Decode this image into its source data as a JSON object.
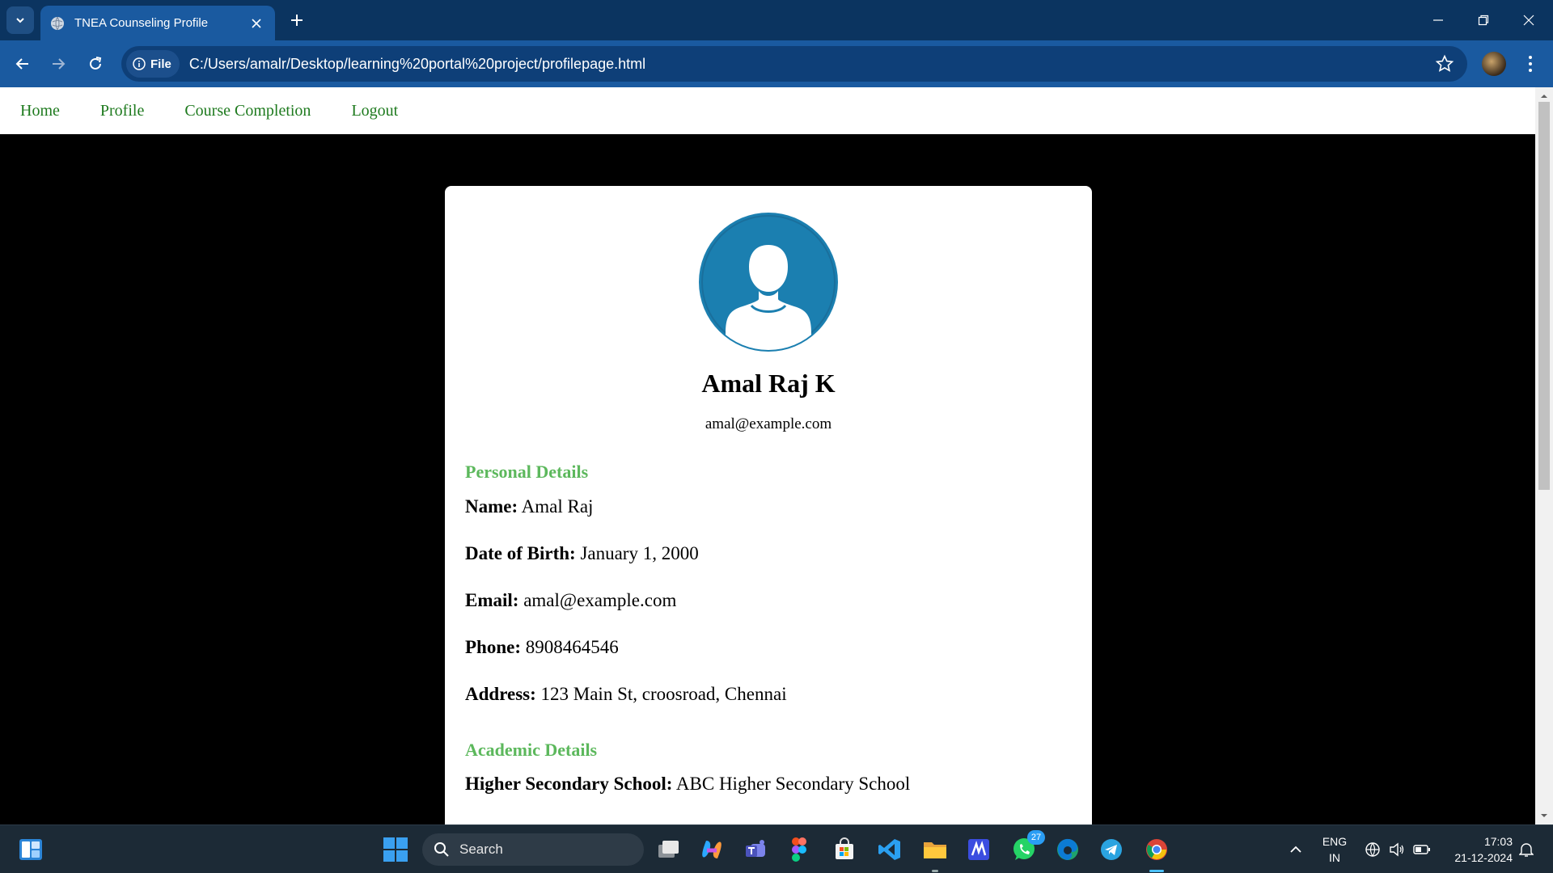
{
  "browser": {
    "tab_title": "TNEA Counseling Profile",
    "omnibox_chip": "File",
    "url": "C:/Users/amalr/Desktop/learning%20portal%20project/profilepage.html"
  },
  "site_nav": {
    "items": [
      "Home",
      "Profile",
      "Course Completion",
      "Logout"
    ]
  },
  "profile": {
    "name": "Amal Raj K",
    "email": "amal@example.com",
    "personal_title": "Personal Details",
    "personal": [
      {
        "label": "Name:",
        "value": "Amal Raj"
      },
      {
        "label": "Date of Birth:",
        "value": "January 1, 2000"
      },
      {
        "label": "Email:",
        "value": "amal@example.com"
      },
      {
        "label": "Phone:",
        "value": "8908464546"
      },
      {
        "label": "Address:",
        "value": "123 Main St, croosroad, Chennai"
      }
    ],
    "academic_title": "Academic Details",
    "academic": [
      {
        "label": "Higher Secondary School:",
        "value": "ABC Higher Secondary School"
      }
    ]
  },
  "taskbar": {
    "search_placeholder": "Search",
    "whatsapp_badge": "27",
    "lang_line1": "ENG",
    "lang_line2": "IN",
    "time": "17:03",
    "date": "21-12-2024"
  },
  "colors": {
    "nav_link": "#1e7a1e",
    "section_heading": "#5cb85c",
    "avatar_circle": "#1b7fb0",
    "chrome_tabbar": "#0b3460",
    "chrome_toolbar": "#1a5aa0"
  }
}
